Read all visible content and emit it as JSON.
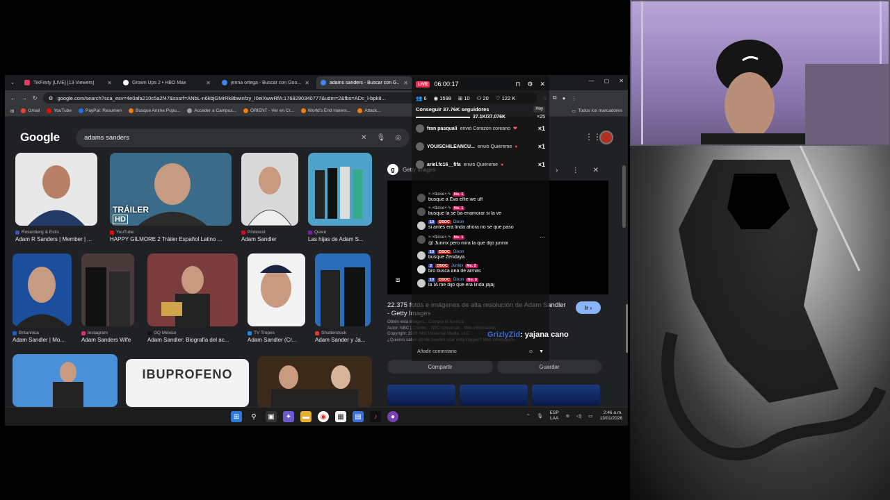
{
  "browser": {
    "tabs": [
      {
        "title": "TikFinity [LIVE] [13 Viewers]",
        "favicon_color": "#e03c5c",
        "active": false
      },
      {
        "title": "Grown Ups 2 • HBO Max",
        "favicon_color": "#ffffff",
        "active": false
      },
      {
        "title": "jenna ortega - Buscar con Goo...",
        "favicon_color": "#4285f4",
        "active": false
      },
      {
        "title": "adams sanders - Buscar con G...",
        "favicon_color": "#4285f4",
        "active": true
      }
    ],
    "url": "google.com/search?sca_esv=4e0afa210c5a2f47&sxsrf=ANbL-n6kbjGMrRk8bwinfzy_I0eiXwwRfA:1768290340777&udm=2&fbs=ADc_l-bpk8...",
    "bookmarks": [
      {
        "label": "Gmail",
        "color": "#ea4335"
      },
      {
        "label": "YouTube",
        "color": "#ff0000"
      },
      {
        "label": "PayPal: Resumen",
        "color": "#1a73e8"
      },
      {
        "label": "Busque Anime Popu...",
        "color": "#f57c00"
      },
      {
        "label": "Acceder a Campus...",
        "color": "#9e9e9e"
      },
      {
        "label": "ORIENT - Ver en Cr...",
        "color": "#f57c00"
      },
      {
        "label": "World's End Harem...",
        "color": "#f57c00"
      },
      {
        "label": "Attack...",
        "color": "#f57c00"
      }
    ],
    "bookmarks_folder": "Todos los marcadores"
  },
  "google": {
    "logo": "Google",
    "query": "adams sanders",
    "results": [
      {
        "source": "Rosenberg & Estis",
        "caption": "Adam R Sanders | Member | ...",
        "src_color": "#3f51b5",
        "bg": "#e8e8e8",
        "fg": "#233a66"
      },
      {
        "source": "YouTube",
        "caption": "HAPPY GILMORE 2 Tráiler Español Latino ...",
        "src_color": "#ff0000",
        "bg": "#3a6c8a",
        "fg": "#2b2b2b",
        "overlay": "TRÁILER",
        "overlay2": "HD"
      },
      {
        "source": "Pinterest",
        "caption": "Adam Sandler",
        "src_color": "#e60023",
        "bg": "#d9d9d9",
        "fg": "#3a3a3a"
      },
      {
        "source": "Quien",
        "caption": "Las hijas de Adam S...",
        "src_color": "#7b1fa2",
        "bg": "#4fa3c9",
        "fg": "#222"
      },
      {
        "source": "Britannica",
        "caption": "Adam Sandler | Mo...",
        "src_color": "#1565c0",
        "bg": "#1b4f9c",
        "fg": "#222"
      },
      {
        "source": "Instagram",
        "caption": "Adam Sanders Wife",
        "src_color": "#e1306c",
        "bg": "#4a3a3a",
        "fg": "#111"
      },
      {
        "source": "GQ México",
        "caption": "Adam Sandler: Biografía del ac...",
        "src_color": "#111111",
        "bg": "#7a3c3c",
        "fg": "#cfa44a"
      },
      {
        "source": "TV Tropes",
        "caption": "Adam Sandler (Cr...",
        "src_color": "#1e88e5",
        "bg": "#f2f2f2",
        "fg": "#333"
      },
      {
        "source": "Shutterstock",
        "caption": "Adam Sander y Ja...",
        "src_color": "#e53935",
        "bg": "#2a6dbb",
        "fg": "#222"
      },
      {
        "source": "",
        "caption": "",
        "src_color": "#000",
        "bg": "#4a90d9",
        "fg": "#222"
      },
      {
        "source": "",
        "caption": "",
        "src_color": "#000",
        "bg": "#f3f3f3",
        "fg": "#666",
        "overlay": "IBUPROFENO"
      },
      {
        "source": "",
        "caption": "",
        "src_color": "#000",
        "bg": "#3b2a1a",
        "fg": "#a77"
      }
    ],
    "preview": {
      "site": "Getty Images",
      "title": "22.375 fotos e imágenes de alta resolución de Adam Sandler - Getty Images",
      "meta1": "Obtén esta imagen... Compra la licencia",
      "meta2": "Autor: NBC | Crédito... NBC Universal... Más información",
      "meta3": "Copyright: 2026 NBCUniversal Media, LLC",
      "meta4": "¿Quieres saber dónde puedes usar esta imagen? Más información",
      "go_label": "Ir",
      "share_label": "Compartir",
      "save_label": "Guardar"
    }
  },
  "live": {
    "badge": "LIVE",
    "timer": "06:00:17",
    "stats": [
      "6",
      "1598",
      "10",
      "20",
      "122 K"
    ],
    "goal_label": "Conseguir 37.76K seguidores",
    "goal_today": "Hoy",
    "goal_progress": "37.1K/37.076K",
    "goal_fraction": 1.0,
    "goal_multiplier": "×25",
    "gifts": [
      {
        "user": "fran pasquali",
        "action": "envió Corazón coreano",
        "count": "×1"
      },
      {
        "user": "YOUISCHILEANCU...",
        "action": "envió Quiéreme",
        "count": "×1"
      },
      {
        "user": "ariel.fc16__fifa",
        "action": "envió Quiéreme",
        "count": "×1"
      }
    ],
    "messages": [
      {
        "user": "×·×Ҩose×·ϟ",
        "badges": [
          "No. 1"
        ],
        "text": "busque a Eva elfie we uff"
      },
      {
        "user": "×·×Ҩose×·ϟ",
        "badges": [
          "No. 1"
        ],
        "text": "busque la se ba enamorar si la ve"
      },
      {
        "user": "Dixon",
        "badges": [
          "10",
          "DSOC"
        ],
        "text": "si antes era linda ahora no se que paso"
      },
      {
        "user": "×·×Ҩose×·ϟ",
        "badges": [
          "No. 1"
        ],
        "text": "@ Juninx pero mira la que dijo junnix"
      },
      {
        "user": "Dixon",
        "badges": [
          "10",
          "DSOC"
        ],
        "text": "busque Zendaya"
      },
      {
        "user": "Juninx",
        "badges": [
          "2",
          "DSOC",
          "No. 2"
        ],
        "text": "bro busca ana de armas"
      },
      {
        "user": "Dixon",
        "badges": [
          "10",
          "DSOC",
          "No. 3"
        ],
        "text": "la IA me dijo que era linda jajaj"
      }
    ],
    "comment_placeholder": "Añadir comentario",
    "overlay_user": "GrizlyZid",
    "overlay_text": ": yajana cano"
  },
  "taskbar": {
    "lang": "ESP",
    "lang2": "LAA",
    "time": "2:46 a.m.",
    "date": "13/01/2026"
  }
}
